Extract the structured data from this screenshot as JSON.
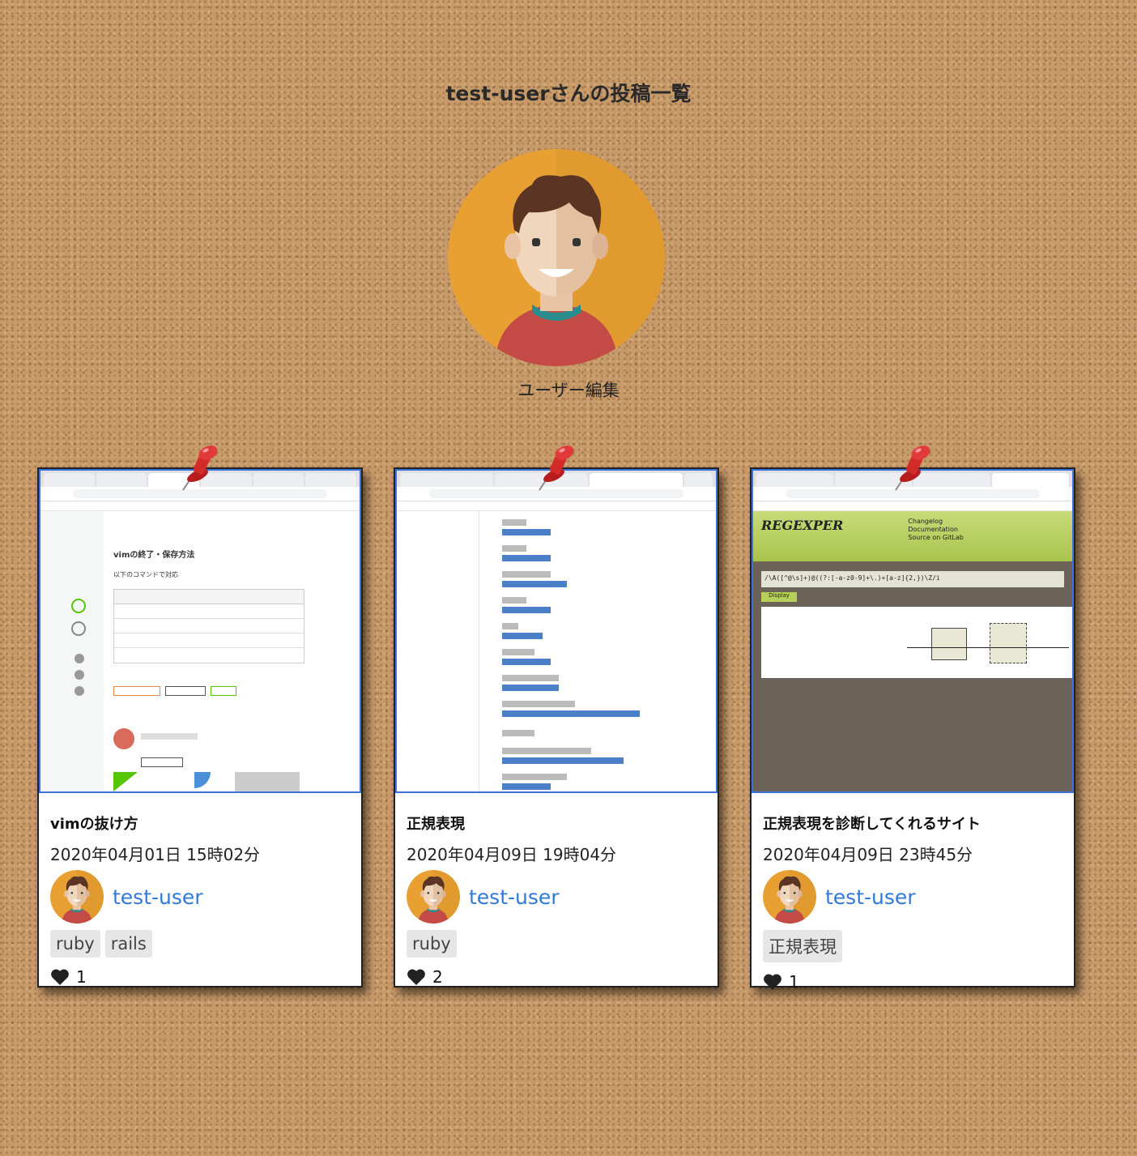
{
  "page": {
    "title": "test-userさんの投稿一覧",
    "edit_link": "ユーザー編集"
  },
  "posts": [
    {
      "title": "vimの抜け方",
      "date": "2020年04月01日 15時02分",
      "user": "test-user",
      "tags": [
        "ruby",
        "rails"
      ],
      "likes": "1"
    },
    {
      "title": "正規表現",
      "date": "2020年04月09日 19時04分",
      "user": "test-user",
      "tags": [
        "ruby"
      ],
      "likes": "2"
    },
    {
      "title": "正規表現を診断してくれるサイト",
      "date": "2020年04月09日 23時45分",
      "user": "test-user",
      "tags": [
        "正規表現"
      ],
      "likes": "1"
    }
  ],
  "thumbnails": {
    "post1": {
      "heading": "vimの終了・保存方法",
      "sub": "以下のコマンドで対応"
    },
    "post3": {
      "logo": "REGEXPER",
      "links": [
        "Changelog",
        "Documentation",
        "Source on GitLab"
      ],
      "regex": "/\\A([^@\\s]+)@((?:[-a-z0-9]+\\.)+[a-z]{2,})\\Z/i",
      "button": "Display"
    }
  },
  "colors": {
    "link": "#2f7ad8",
    "avatar_bg": "#e8a033",
    "thumb_border": "#3b73d9"
  }
}
